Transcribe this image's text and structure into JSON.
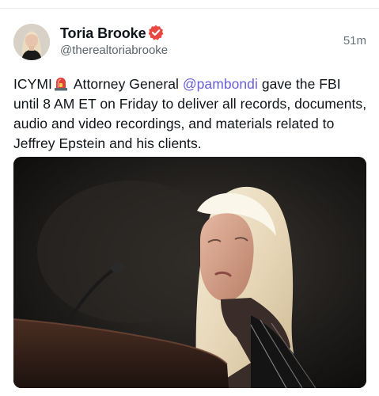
{
  "post": {
    "author": {
      "name": "Toria Brooke",
      "handle": "@therealtoriabrooke",
      "verified_icon": "verified-badge-icon",
      "verified_color": "#e8483f"
    },
    "time": "51m",
    "body": {
      "prefix": "ICYMI",
      "emoji_icon": "siren-icon",
      "text_1": " Attorney General ",
      "mention": "@pambondi",
      "text_2": " gave the FBI until 8 AM ET on Friday to deliver all records, documents, audio and video recordings, and materials related to Jeffrey Epstein and his clients."
    },
    "media": {
      "kind": "photo",
      "icon": "photo-icon"
    },
    "colors": {
      "text": "#0f1419",
      "secondary": "#5b636b",
      "mention": "#6a5ed8"
    }
  }
}
